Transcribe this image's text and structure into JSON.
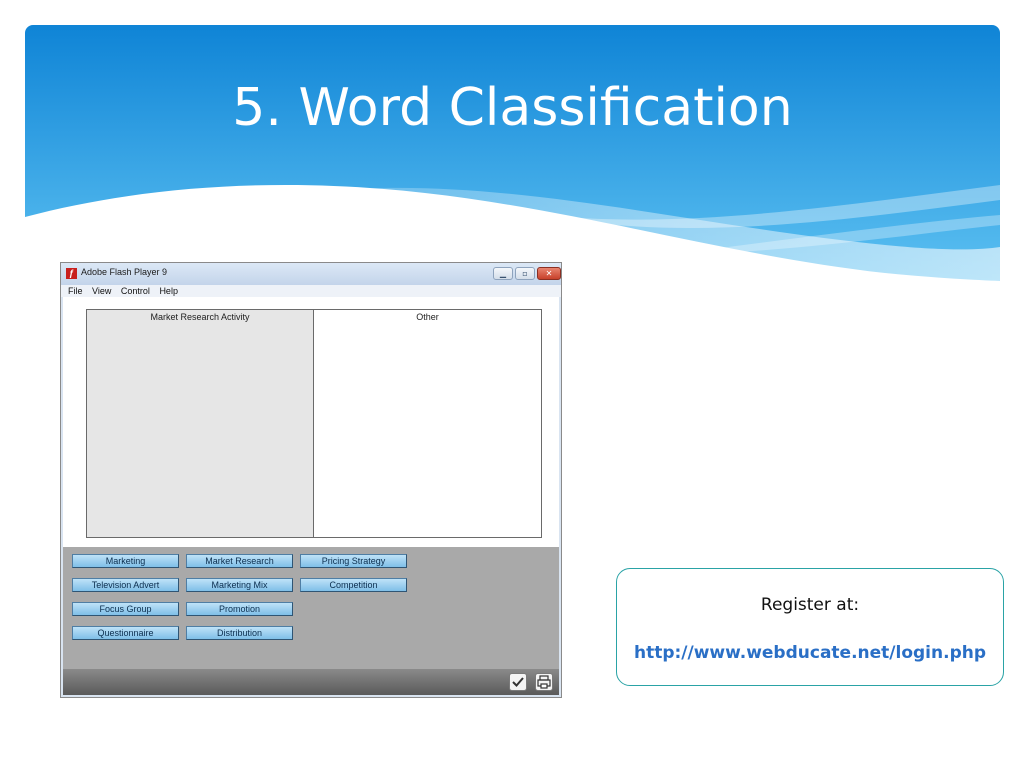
{
  "slide": {
    "title": "5. Word Classification",
    "colors": {
      "banner_top": "#0f84d6",
      "banner_bottom": "#5fc0f0"
    }
  },
  "flash_window": {
    "title": "Adobe Flash Player 9",
    "menu": [
      "File",
      "View",
      "Control",
      "Help"
    ],
    "columns": [
      "Market Research Activity",
      "Other"
    ],
    "word_buttons": [
      "Marketing",
      "Market Research",
      "Pricing Strategy",
      "Television Advert",
      "Marketing Mix",
      "Competition",
      "Focus Group",
      "Promotion",
      "Questionnaire",
      "Distribution"
    ],
    "controls": {
      "check_icon": "check-icon",
      "print_icon": "print-icon"
    }
  },
  "register": {
    "label": "Register at:",
    "link": "http://www.webducate.net/login.php"
  }
}
